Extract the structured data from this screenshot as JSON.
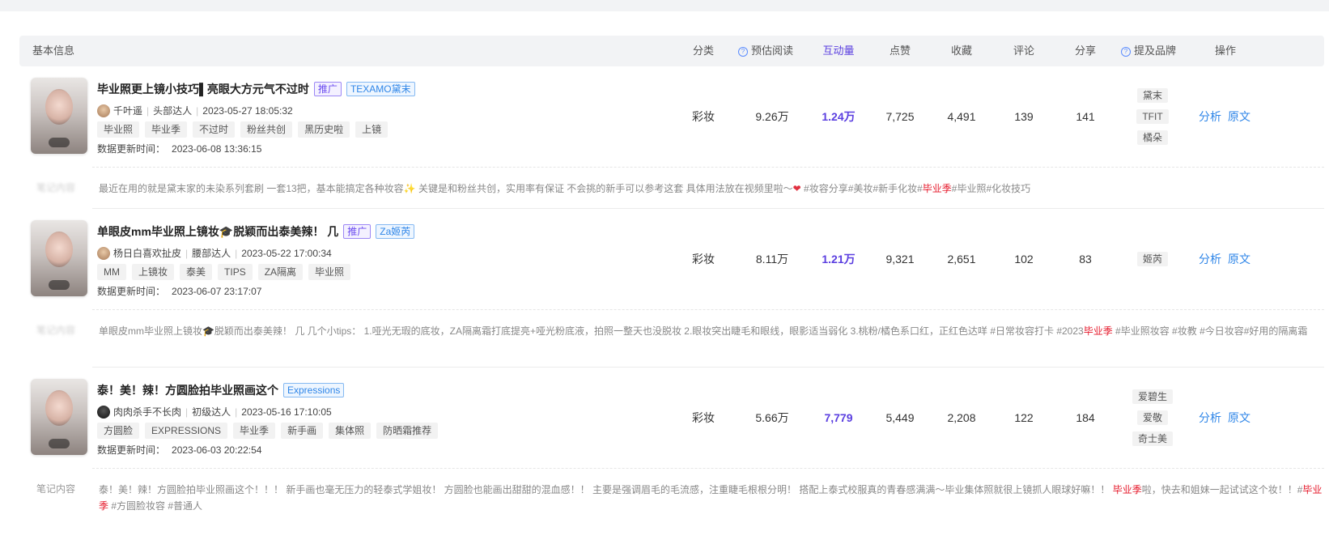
{
  "header": {
    "basic": "基本信息",
    "category": "分类",
    "reads": "预估阅读",
    "interact": "互动量",
    "likes": "点赞",
    "favs": "收藏",
    "comments": "评论",
    "shares": "分享",
    "brands": "提及品牌",
    "ops": "操作"
  },
  "actions": {
    "analyze": "分析",
    "original": "原文"
  },
  "posts": [
    {
      "title": "毕业照更上镜小技巧▌亮眼大方元气不过时",
      "promo": "推广",
      "brand_tag": "TEXAMO黛末",
      "author": "千叶遥",
      "level": "头部达人",
      "date": "2023-05-27 18:05:32",
      "tags": [
        "毕业照",
        "毕业季",
        "不过时",
        "粉丝共创",
        "黑历史啦",
        "上镜"
      ],
      "updated_label": "数据更新时间：",
      "updated_time": "2023-06-08 13:36:15",
      "category": "彩妆",
      "reads": "9.26万",
      "interact": "1.24万",
      "likes": "7,725",
      "favs": "4,491",
      "comments": "139",
      "shares": "141",
      "brands": [
        "黛末",
        "TFIT",
        "橘朵"
      ],
      "content_label": "笔记内容",
      "content_a": "最近在用的就是黛末家的未染系列套刷 一套13把，基本能搞定各种妆容",
      "content_b": " 关键是和粉丝共创，实用率有保证 不会挑的新手可以参考这套 具体用法放在视频里啦～",
      "content_c": " #妆容分享#美妆#新手化妆#",
      "content_hl": "毕业季",
      "content_d": "#毕业照#化妆技巧"
    },
    {
      "title": "单眼皮mm毕业照上镜妆🎓脱颖而出泰美辣！ 几",
      "promo": "推广",
      "brand_tag": "Za姬芮",
      "author": "杨日白喜欢扯皮",
      "level": "腰部达人",
      "date": "2023-05-22 17:00:34",
      "tags": [
        "MM",
        "上镜妆",
        "泰美",
        "TIPS",
        "ZA隔离",
        "毕业照"
      ],
      "updated_label": "数据更新时间：",
      "updated_time": "2023-06-07 23:17:07",
      "category": "彩妆",
      "reads": "8.11万",
      "interact": "1.21万",
      "likes": "9,321",
      "favs": "2,651",
      "comments": "102",
      "shares": "83",
      "brands": [
        "姬芮"
      ],
      "content_label": "笔记内容",
      "content_a": "单眼皮mm毕业照上镜妆🎓脱颖而出泰美辣！ 几 几个小tips： 1.哑光无瑕的底妆，ZA隔离霜打底提亮+哑光粉底液，拍照一整天也没脱妆 2.眼妆突出睫毛和眼线，眼影适当弱化 3.桃粉/橘色系口红，正红色达咩 #日常妆容打卡 #2023",
      "content_hl": "毕业季",
      "content_d": " #毕业照妆容 #妆教 #今日妆容#好用的隔离霜"
    },
    {
      "title": "泰！美！辣！方圆脸拍毕业照画这个",
      "brand_tag": "Expressions",
      "author": "肉肉杀手不长肉",
      "level": "初级达人",
      "date": "2023-05-16 17:10:05",
      "tags": [
        "方圆脸",
        "EXPRESSIONS",
        "毕业季",
        "新手画",
        "集体照",
        "防晒霜推荐"
      ],
      "updated_label": "数据更新时间：",
      "updated_time": "2023-06-03 20:22:54",
      "category": "彩妆",
      "reads": "5.66万",
      "interact": "7,779",
      "likes": "5,449",
      "favs": "2,208",
      "comments": "122",
      "shares": "184",
      "brands": [
        "爱碧生",
        "爱敬",
        "奇士美"
      ],
      "content_label": "笔记内容",
      "content_a": "泰！美！辣！方圆脸拍毕业照画这个！！！ 新手画也毫无压力的轻泰式学姐妆！ 方圆脸也能画出甜甜的混血感！！ 主要是强调眉毛的毛流感，注重睫毛根根分明！ 搭配上泰式校服真的青春感满满～毕业集体照就很上镜抓人眼球好嘛！！ ",
      "content_hl": "毕业季",
      "content_d": "啦，快去和姐妹一起试试这个妆！！#",
      "content_hl2": "毕业季",
      "content_e": " #方圆脸妆容 #普通人"
    }
  ]
}
